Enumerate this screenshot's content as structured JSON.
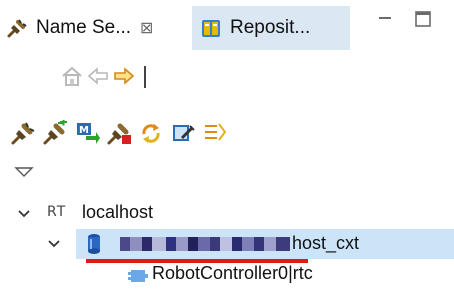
{
  "tabs": [
    {
      "label": "Name Se...",
      "icon": "plug-icon",
      "active": true,
      "close": "⊠"
    },
    {
      "label": "Reposit...",
      "icon": "repository-icon",
      "active": false
    }
  ],
  "window_controls": [
    "minimize-icon",
    "maximize-icon"
  ],
  "nav_toolbar": [
    "home-icon",
    "back-arrow-icon",
    "forward-arrow-icon"
  ],
  "action_toolbar": [
    "connect-plug-icon",
    "add-nameserver-icon",
    "manager-icon",
    "disconnect-plug-icon",
    "refresh-icon",
    "edit-icon",
    "filter-icon"
  ],
  "view_menu_icon": "chevron-down-icon",
  "tree": {
    "host": {
      "badge": "RT",
      "label": "localhost"
    },
    "context": {
      "label_suffix": "host_cxt",
      "icon": "database-icon",
      "obscured": true
    },
    "component": {
      "label": "RobotController0|rtc",
      "icon": "component-icon"
    }
  },
  "colors": {
    "selection": "#cce4f7",
    "inactive_tab": "#dbe7f3",
    "annotation_underline": "#e01818"
  }
}
